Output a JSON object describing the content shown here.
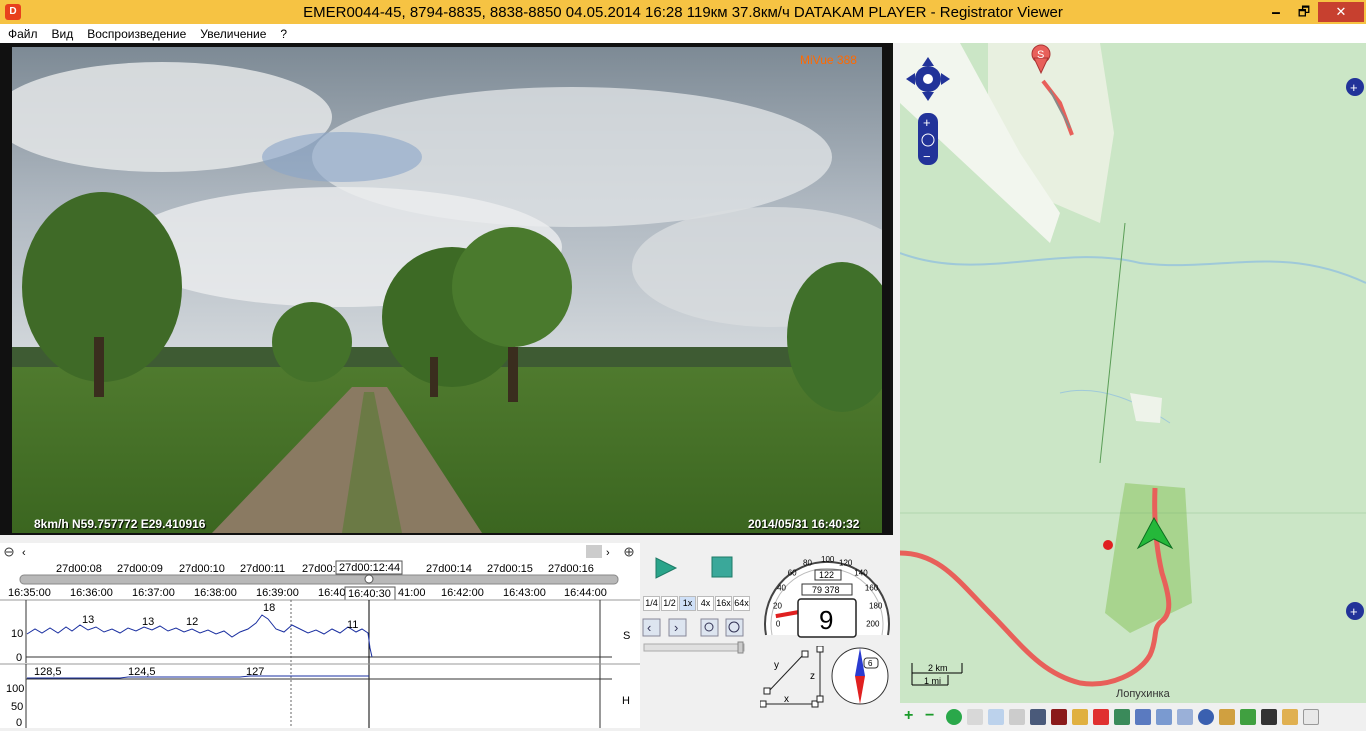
{
  "window": {
    "title": "EMER0044-45, 8794-8835, 8838-8850    04.05.2014 16:28    119км    37.8км/ч    DATAKAM PLAYER - Registrator Viewer",
    "minimize": "🗕",
    "maximize": "🗗",
    "close": "✕",
    "app_icon": "D"
  },
  "menu": [
    "Файл",
    "Вид",
    "Воспроизведение",
    "Увеличение",
    "?"
  ],
  "video": {
    "brand": "MiVue 388",
    "gps_text": "8km/h N59.757772 E29.410916",
    "datetime": "2014/05/31 16:40:32"
  },
  "timeline": {
    "frame_labels": [
      "27d00:08",
      "27d00:09",
      "27d00:10",
      "27d00:11",
      "27d00:",
      "27d00:12:44",
      "27d00:14",
      "27d00:15",
      "27d00:16"
    ],
    "time_labels": [
      "16:35:00",
      "16:36:00",
      "16:37:00",
      "16:38:00",
      "16:39:00",
      "16:40",
      "16:40:30",
      "41:00",
      "16:42:00",
      "16:43:00",
      "16:44:00"
    ],
    "speed_chart": {
      "axis_ticks": [
        "10",
        "0"
      ],
      "annotations": [
        "13",
        "13",
        "12",
        "18",
        "11"
      ],
      "side_label": "S"
    },
    "height_chart": {
      "axis_ticks": [
        "100",
        "50",
        "0"
      ],
      "annotations": [
        "128,5",
        "124,5",
        "127"
      ],
      "side_label": "H"
    }
  },
  "playback": {
    "speeds": [
      "1/4",
      "1/2",
      "1x",
      "4x",
      "16x",
      "64x"
    ],
    "active_speed": "1x"
  },
  "speedometer": {
    "ticks": [
      "0",
      "20",
      "40",
      "60",
      "80",
      "100",
      "120",
      "140",
      "160",
      "180",
      "200"
    ],
    "speed_value": "9",
    "odometer_top": "122",
    "odometer": "79 378",
    "needle_speed": 9
  },
  "axes_widget": {
    "y": "y",
    "x": "x",
    "z": "z"
  },
  "compass": {
    "value": "6"
  },
  "map": {
    "start_marker": "S",
    "place_label": "Лопухинка",
    "scale_km": "2 km",
    "scale_mi": "1 mi"
  },
  "colors": {
    "title_bg": "#f6c343",
    "track": "#e8605a",
    "map_bg": "#c9e8c4",
    "chart_line": "#1a2fa0"
  }
}
